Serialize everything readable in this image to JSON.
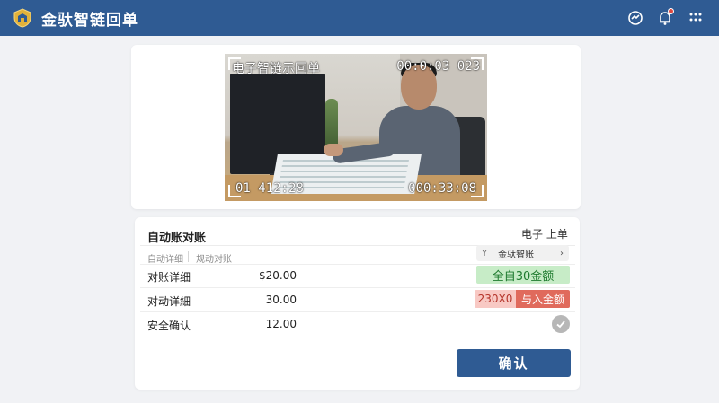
{
  "app": {
    "title": "金驮智链回单"
  },
  "header": {
    "icons": [
      "messenger-icon",
      "bell-icon",
      "grid-menu-icon"
    ]
  },
  "video": {
    "overlay_title": "电子智链示回单",
    "timestamp_top_right": "00:0:03 023",
    "timestamp_bottom_left": "01 412:28",
    "timestamp_bottom_right": "000:33:08"
  },
  "detail": {
    "section_title": "自动账对账",
    "section_right": "电子 上单",
    "tabs": [
      "自动详细",
      "规动对账"
    ],
    "selector": {
      "prefix": "Y",
      "label": "金驮智账",
      "chevron": "›"
    },
    "rows": [
      {
        "label": "对账详细",
        "value": "$20.00"
      },
      {
        "label": "对动详細",
        "value": "30.00"
      },
      {
        "label": "安全确认",
        "value": "12.00"
      }
    ],
    "tag_green": "全自30金额",
    "tag_red_light": "230X0",
    "tag_red": "与入金额",
    "confirm_label": "确认"
  },
  "colors": {
    "header_bg": "#2f5b93",
    "accent": "#2f5b93",
    "success_bg": "#c7ecc7",
    "danger": "#e06a5c"
  }
}
